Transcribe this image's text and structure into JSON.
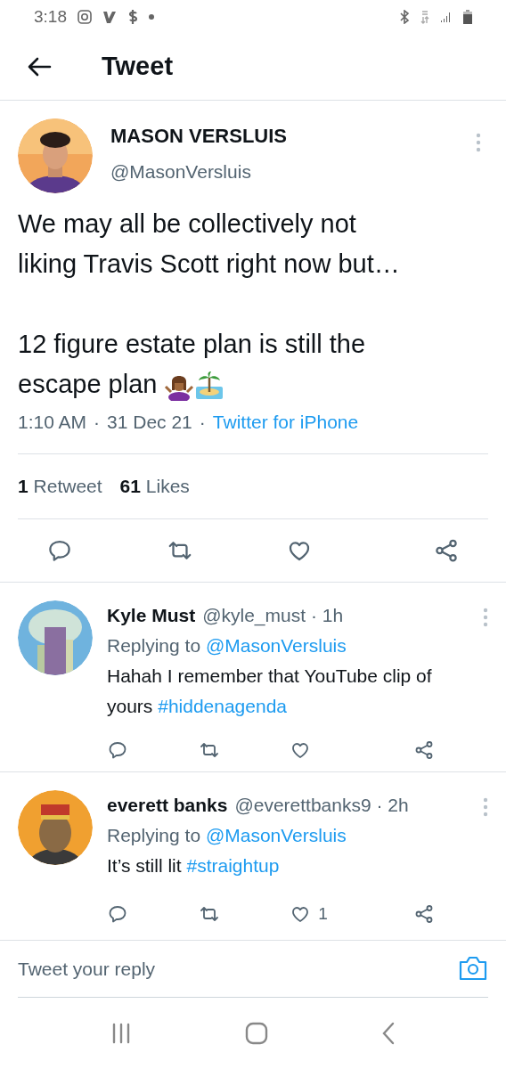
{
  "status_bar": {
    "time": "3:18"
  },
  "header": {
    "title": "Tweet"
  },
  "tweet": {
    "name": "MASON VERSLUIS",
    "handle": "@MasonVersluis",
    "paragraphs": [
      "We may all be collectively not liking Travis Scott right now but…",
      "12 figure estate plan is still the escape plan"
    ],
    "time": "1:10 AM",
    "separator": "·",
    "date": "31 Dec 21",
    "source": "Twitter for iPhone",
    "retweets": {
      "count": "1",
      "label": "Retweet"
    },
    "likes": {
      "count": "61",
      "label": "Likes"
    }
  },
  "replies": [
    {
      "name": "Kyle Must",
      "handle": "@kyle_must",
      "separator": "·",
      "age": "1h",
      "replying_label": "Replying to",
      "replying_to": "@MasonVersluis",
      "text": "Hahah I remember that YouTube clip of yours",
      "hashtag": "#hiddenagenda"
    },
    {
      "name": "everett banks",
      "handle": "@everettbanks9",
      "separator": "·",
      "age": "2h",
      "replying_label": "Replying to",
      "replying_to": "@MasonVersluis",
      "text": "It’s still lit",
      "hashtag": "#straightup",
      "like_count": "1"
    }
  ],
  "reply_field": {
    "placeholder": "Tweet your reply"
  }
}
